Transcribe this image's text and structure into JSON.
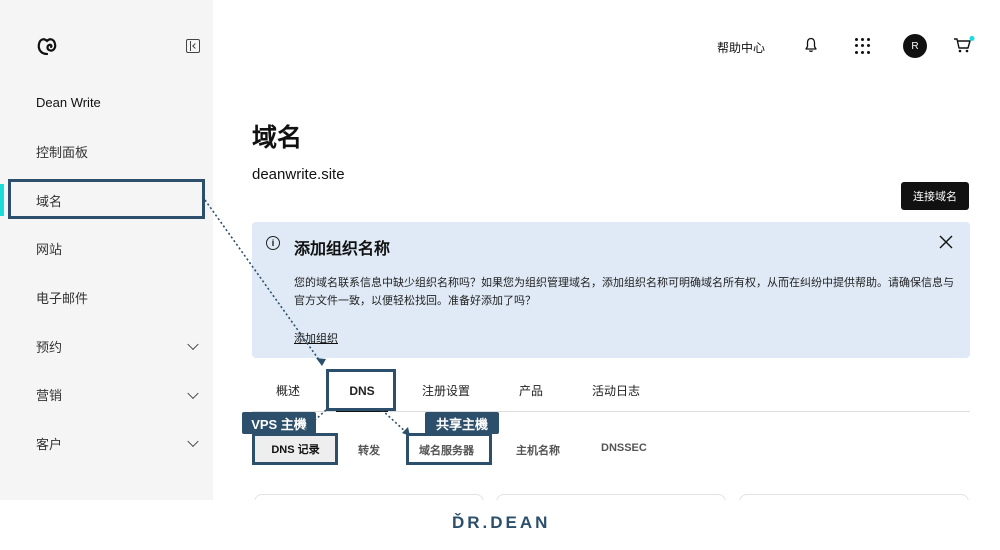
{
  "sidebar": {
    "account_name": "Dean Write",
    "items": [
      {
        "label": "控制面板",
        "has_chevron": false
      },
      {
        "label": "域名",
        "has_chevron": false,
        "active": true
      },
      {
        "label": "网站",
        "has_chevron": false
      },
      {
        "label": "电子邮件",
        "has_chevron": false
      },
      {
        "label": "预约",
        "has_chevron": true
      },
      {
        "label": "营销",
        "has_chevron": true
      },
      {
        "label": "客户",
        "has_chevron": true
      }
    ]
  },
  "header": {
    "help": "帮助中心",
    "avatar_initial": "R"
  },
  "main": {
    "title": "域名",
    "domain": "deanwrite.site",
    "connect_button": "连接域名"
  },
  "banner": {
    "title": "添加组织名称",
    "text": "您的域名联系信息中缺少组织名称吗？如果您为组织管理域名，添加组织名称可明确域名所有权，从而在纠纷中提供帮助。请确保信息与官方文件一致，以便轻松找回。准备好添加了吗？",
    "link": "添加组织"
  },
  "tabs": [
    "概述",
    "DNS",
    "注册设置",
    "产品",
    "活动日志"
  ],
  "subtabs": [
    "DNS 记录",
    "转发",
    "域名服务器",
    "主机名称",
    "DNSSEC"
  ],
  "annotations": {
    "vps": "VPS 主機",
    "shared": "共享主機"
  },
  "brand": "ĎR.DEAN",
  "colors": {
    "accent": "#1bdbdb",
    "annotation": "#2c4f6b",
    "banner_bg": "#dfeaf6"
  }
}
